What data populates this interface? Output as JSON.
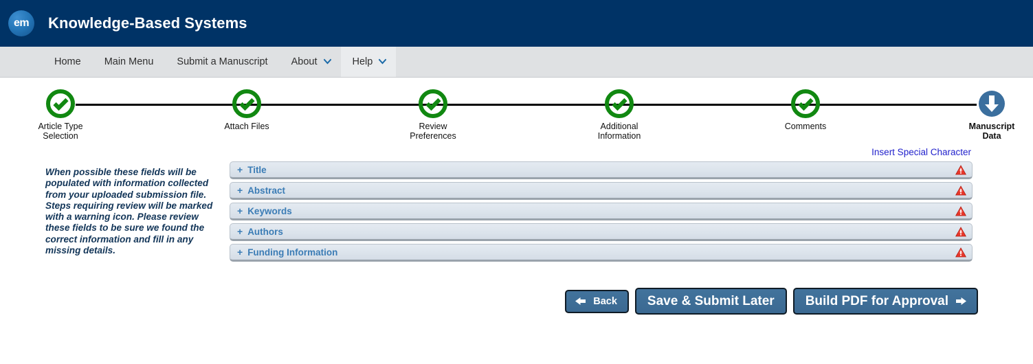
{
  "header": {
    "logo_text": "em",
    "title": "Knowledge-Based Systems",
    "bg_color": "#003366"
  },
  "nav": {
    "items": [
      {
        "label": "Home",
        "caret": false,
        "active": false
      },
      {
        "label": "Main Menu",
        "caret": false,
        "active": false
      },
      {
        "label": "Submit a Manuscript",
        "caret": false,
        "active": false
      },
      {
        "label": "About",
        "caret": true,
        "active": false
      },
      {
        "label": "Help",
        "caret": true,
        "active": true
      }
    ]
  },
  "stepper": {
    "steps": [
      {
        "line1": "Article Type",
        "line2": "Selection",
        "state": "complete"
      },
      {
        "line1": "Attach Files",
        "line2": "",
        "state": "complete"
      },
      {
        "line1": "Review",
        "line2": "Preferences",
        "state": "complete"
      },
      {
        "line1": "Additional",
        "line2": "Information",
        "state": "complete"
      },
      {
        "line1": "Comments",
        "line2": "",
        "state": "complete"
      },
      {
        "line1": "Manuscript",
        "line2": "Data",
        "state": "current"
      }
    ],
    "complete_color": "#118811",
    "current_color": "#3b6f9e"
  },
  "main": {
    "special_character_link": "Insert Special Character",
    "help_text": "When possible these fields will be populated with information collected from your uploaded submission file. Steps requiring review will be marked with a warning icon. Please review these fields to be sure we found the correct information and fill in any missing details.",
    "panels": [
      {
        "label": "Title",
        "expander": "+",
        "warning": true
      },
      {
        "label": "Abstract",
        "expander": "+",
        "warning": true
      },
      {
        "label": "Keywords",
        "expander": "+",
        "warning": true
      },
      {
        "label": "Authors",
        "expander": "+",
        "warning": true
      },
      {
        "label": "Funding Information",
        "expander": "+",
        "warning": true
      }
    ],
    "panel_label_color": "#3b7cb5",
    "warning_color": "#d42a1e"
  },
  "buttons": {
    "back": "Back",
    "save_submit_later": "Save & Submit Later",
    "build_pdf": "Build PDF for Approval",
    "fill_color": "#3f6f98"
  }
}
